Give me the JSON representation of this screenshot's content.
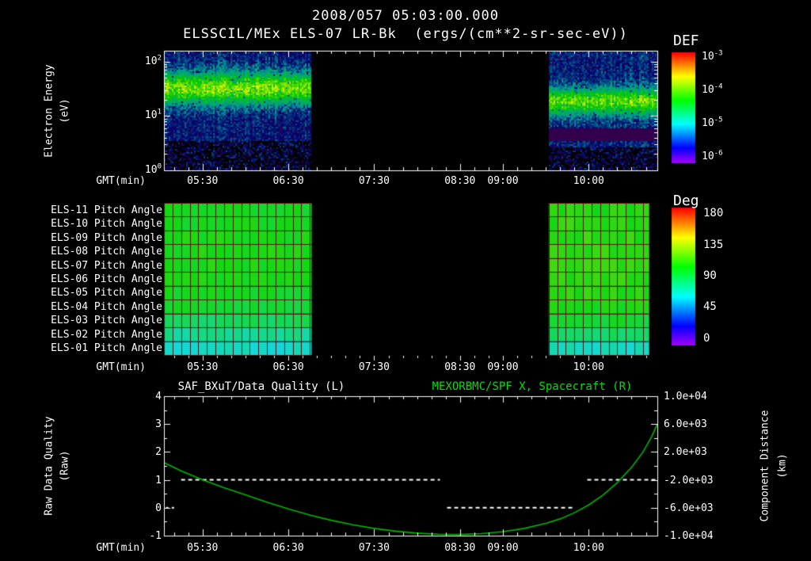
{
  "colors": {
    "background": "#000000",
    "text": "#ffffff",
    "title_green": "#00e000",
    "curve_green": "#00b800",
    "pitch_grid": "#5c1414",
    "axis": "#ffffff"
  },
  "labels": {
    "timestamp": "2008/057 05:03:00.000",
    "plot_title": "ELSSCIL/MEx ELS-07 LR-Bk  (ergs/(cm**2-sr-sec-eV))",
    "def": "DEF",
    "deg": "Deg",
    "gmt": "GMT(min)",
    "electron_energy": "Electron Energy",
    "ev": "(eV)",
    "quality_title": "SAF_BXuT/Data Quality (L)",
    "distance_title": "MEXORBMC/SPF X, Spacecraft (R)",
    "raw_quality": "Raw Data Quality",
    "raw": "(Raw)",
    "component_distance": "Component Distance",
    "km": "(km)"
  },
  "time_axis": {
    "label": "GMT(min)",
    "start_min": 303,
    "end_min": 648,
    "minor_step_min": 10,
    "ticks": [
      {
        "label": "05:30",
        "t": 330
      },
      {
        "label": "06:30",
        "t": 390
      },
      {
        "label": "07:30",
        "t": 450
      },
      {
        "label": "08:30",
        "t": 510
      },
      {
        "label": "09:00",
        "t": 540
      },
      {
        "label": "10:00",
        "t": 600
      }
    ]
  },
  "chart_data": [
    {
      "type": "heatmap",
      "name": "electron_energy_spectrogram",
      "title": "ELSSCIL/MEx ELS-07 LR-Bk",
      "units": "ergs/(cm**2-sr-sec-eV)",
      "xlabel": "GMT(min)",
      "ylabel": "Electron Energy (eV)",
      "y_scale": "log",
      "y_top_log": 2.2,
      "y_ticks": [
        {
          "text": "10^2",
          "log": 2
        },
        {
          "text": "10^1",
          "log": 1
        },
        {
          "text": "10^0",
          "log": 0
        }
      ],
      "colorbar": {
        "title": "DEF",
        "scale": "log",
        "ticks": [
          {
            "text": "10^-3",
            "frac": 0.043
          },
          {
            "text": "10^-4",
            "frac": 0.343
          },
          {
            "text": "10^-5",
            "frac": 0.643
          },
          {
            "text": "10^-6",
            "frac": 0.943
          }
        ]
      },
      "segments": [
        {
          "start": "05:03",
          "end": "06:46",
          "t0": 303,
          "t1": 406,
          "band_center_eV": 33,
          "band_center_log": 1.52,
          "band_sigma_log": 0.22,
          "band_peak_v": 0.5,
          "background_v": 0.18,
          "sparse_below_log": 0.55,
          "dark_band_log": null
        },
        {
          "start": "09:32",
          "end": "10:48",
          "t0": 572,
          "t1": 648,
          "band_center_eV": 19,
          "band_center_log": 1.28,
          "band_sigma_log": 0.18,
          "band_peak_v": 0.46,
          "background_v": 0.2,
          "sparse_below_log": 0.45,
          "dark_band_log": 0.68
        }
      ]
    },
    {
      "type": "heatmap",
      "name": "pitch_angle_panel",
      "units": "Deg",
      "cell_minutes": 6,
      "rows": [
        "ELS-11 Pitch Angle",
        "ELS-10 Pitch Angle",
        "ELS-09 Pitch Angle",
        "ELS-08 Pitch Angle",
        "ELS-07 Pitch Angle",
        "ELS-06 Pitch Angle",
        "ELS-05 Pitch Angle",
        "ELS-04 Pitch Angle",
        "ELS-03 Pitch Angle",
        "ELS-02 Pitch Angle",
        "ELS-01 Pitch Angle"
      ],
      "colorbar": {
        "title": "Deg",
        "range": [
          0,
          180
        ],
        "ticks": [
          {
            "text": "180",
            "frac": 0.046
          },
          {
            "text": "135",
            "frac": 0.273
          },
          {
            "text": "90",
            "frac": 0.5
          },
          {
            "text": "45",
            "frac": 0.727
          },
          {
            "text": "0",
            "frac": 0.954
          }
        ]
      },
      "segments": [
        {
          "t0": 303,
          "t1": 406,
          "row_mean_deg": [
            100,
            101,
            102,
            103,
            103,
            102,
            100,
            96,
            88,
            78,
            68
          ]
        },
        {
          "t0": 572,
          "t1": 642,
          "row_mean_deg": [
            106,
            107,
            108,
            109,
            109,
            108,
            106,
            103,
            97,
            87,
            70
          ]
        }
      ]
    },
    {
      "type": "line",
      "name": "quality_and_distance",
      "xlabel": "GMT(min)",
      "left_axis": {
        "label": "Raw Data Quality (Raw)",
        "range": [
          -1,
          4
        ],
        "ticks": [
          {
            "text": "4",
            "v": 4
          },
          {
            "text": "3",
            "v": 3
          },
          {
            "text": "2",
            "v": 2
          },
          {
            "text": "1",
            "v": 1
          },
          {
            "text": "0",
            "v": 0
          },
          {
            "text": "-1",
            "v": -1
          }
        ]
      },
      "right_axis": {
        "label": "Component Distance (km)",
        "range": [
          -10000,
          10000
        ],
        "ticks": [
          {
            "text": "1.0e+04",
            "v": 4
          },
          {
            "text": "6.0e+03",
            "v": 3
          },
          {
            "text": "2.0e+03",
            "v": 2
          },
          {
            "text": "-2.0e+03",
            "v": 1
          },
          {
            "text": "-6.0e+03",
            "v": 0
          },
          {
            "text": "-1.0e+04",
            "v": -1
          }
        ]
      },
      "series": [
        {
          "name": "SAF_BXuT/Data Quality (L)",
          "axis": "left",
          "style": "dashed_white",
          "segments": [
            {
              "t0": 315,
              "t1": 496,
              "value": 1
            },
            {
              "t0": 501,
              "t1": 589,
              "value": 0
            },
            {
              "t0": 599,
              "t1": 648,
              "value": 1
            }
          ],
          "points": [
            {
              "t": 305,
              "value": 0
            },
            {
              "t": 309,
              "value": 0
            }
          ]
        },
        {
          "name": "MEXORBMC/SPF X, Spacecraft (R)",
          "axis": "right",
          "style": "solid_green",
          "samples_t_km": [
            [
              303,
              480
            ],
            [
              315,
              -720
            ],
            [
              330,
              -2000
            ],
            [
              345,
              -3120
            ],
            [
              360,
              -4160
            ],
            [
              375,
              -5200
            ],
            [
              390,
              -6160
            ],
            [
              405,
              -7040
            ],
            [
              420,
              -7800
            ],
            [
              435,
              -8440
            ],
            [
              450,
              -8960
            ],
            [
              465,
              -9360
            ],
            [
              480,
              -9640
            ],
            [
              495,
              -9800
            ],
            [
              510,
              -9840
            ],
            [
              525,
              -9720
            ],
            [
              540,
              -9440
            ],
            [
              555,
              -8960
            ],
            [
              570,
              -8240
            ],
            [
              580,
              -7600
            ],
            [
              590,
              -6720
            ],
            [
              600,
              -5600
            ],
            [
              610,
              -4200
            ],
            [
              620,
              -2400
            ],
            [
              630,
              -200
            ],
            [
              638,
              2000
            ],
            [
              644,
              4200
            ],
            [
              648,
              6000
            ]
          ]
        }
      ]
    }
  ]
}
